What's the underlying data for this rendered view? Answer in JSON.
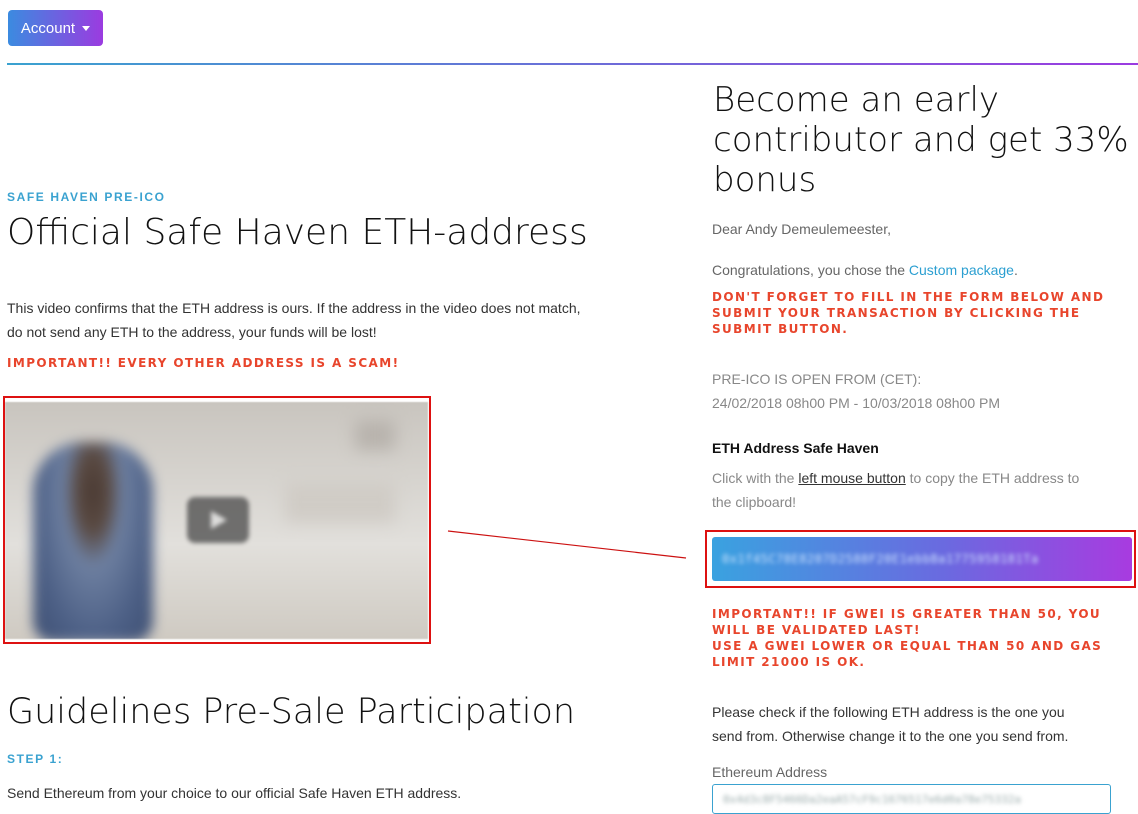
{
  "header": {
    "account_label": "Account"
  },
  "left": {
    "eyebrow": "SAFE HAVEN PRE-ICO",
    "title": "Official Safe Haven ETH-address",
    "description_line1": "This video confirms that the ETH address is ours. If the address in the video does not match,",
    "description_line2": "do not send any ETH to the address, your funds will be lost!",
    "scam_warning": "IMPORTANT!! EVERY OTHER ADDRESS IS A SCAM!",
    "guidelines_title": "Guidelines Pre-Sale Participation",
    "step_label": "STEP 1:",
    "step_text": "Send Ethereum from your choice to our official Safe Haven ETH address."
  },
  "right": {
    "headline_line1": "Become an early",
    "headline_line2": "contributor and get 33%",
    "headline_line3": "bonus",
    "greeting": "Dear Andy Demeulemeester,",
    "congrats_prefix": "Congratulations, you chose the ",
    "package_link": "Custom package",
    "congrats_suffix": ".",
    "form_warning_line1": "DON'T FORGET TO FILL IN THE FORM BELOW AND",
    "form_warning_line2": "SUBMIT YOUR TRANSACTION BY CLICKING THE",
    "form_warning_line3": "SUBMIT BUTTON.",
    "open_label": "PRE-ICO IS OPEN FROM (CET):",
    "open_range": "24/02/2018 08h00 PM - 10/03/2018 08h00 PM",
    "eth_heading": "ETH Address Safe Haven",
    "copy_prefix": "Click with the ",
    "copy_link": "left mouse button",
    "copy_suffix": " to copy the ETH address to",
    "copy_line2": "the clipboard!",
    "eth_address": "0x1f45C78E8207D2588F20E1ebbBa1775958181Ta",
    "gwei_line1": "IMPORTANT!! IF GWEI IS GREATER THAN 50, YOU",
    "gwei_line2": "WILL BE VALIDATED LAST!",
    "gwei_line3": "USE A GWEI LOWER OR EQUAL THAN 50 AND GAS",
    "gwei_line4": "LIMIT 21000 IS OK.",
    "check_line1": "Please check if the following ETH address is the one you",
    "check_line2": "send from. Otherwise change it to the one you send from.",
    "eth_field_label": "Ethereum Address",
    "eth_field_value": "0x4d3c8F5466Da2eaA57cF9c1676517e6d0a78e75332a"
  },
  "colors": {
    "accent_blue": "#3aa2d0",
    "accent_purple": "#9b3be0",
    "warning": "#e8452c",
    "highlight_red": "#dd1111"
  }
}
